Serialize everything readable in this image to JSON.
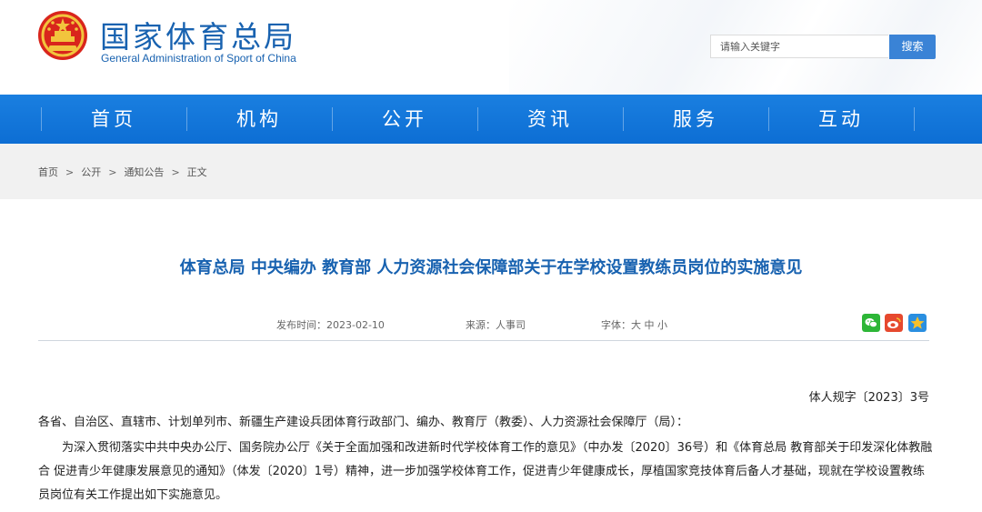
{
  "header": {
    "title": "国家体育总局",
    "subtitle": "General Administration of Sport of China",
    "emblem_icon": "national-emblem-icon"
  },
  "search": {
    "placeholder": "请输入关键字",
    "button_label": "搜索"
  },
  "nav": {
    "items": [
      {
        "label": "首页"
      },
      {
        "label": "机构"
      },
      {
        "label": "公开"
      },
      {
        "label": "资讯"
      },
      {
        "label": "服务"
      },
      {
        "label": "互动"
      }
    ]
  },
  "breadcrumb": {
    "items": [
      "首页",
      "公开",
      "通知公告",
      "正文"
    ],
    "separator": ">"
  },
  "article": {
    "title": "体育总局 中央编办 教育部 人力资源社会保障部关于在学校设置教练员岗位的实施意见",
    "publish_time": "发布时间：2023-02-10",
    "source": "来源：人事司",
    "font_size_label": "字体：大 中 小",
    "share_icons": [
      "wechat-icon",
      "weibo-icon",
      "qzone-icon"
    ],
    "doc_number": "体人规字〔2023〕3号",
    "addressee": "各省、自治区、直辖市、计划单列市、新疆生产建设兵团体育行政部门、编办、教育厅（教委）、人力资源社会保障厅（局）：",
    "paragraph_1": "为深入贯彻落实中共中央办公厅、国务院办公厅《关于全面加强和改进新时代学校体育工作的意见》（中办发〔2020〕36号）和《体育总局 教育部关于印发深化体教融合 促进青少年健康发展意见的通知》（体发〔2020〕1号）精神，进一步加强学校体育工作，促进青少年健康成长，厚植国家竞技体育后备人才基础，现就在学校设置教练员岗位有关工作提出如下实施意见。"
  },
  "colors": {
    "brand_blue": "#1862b0",
    "nav_blue": "#0d6ed4",
    "search_button": "#3a83d6"
  }
}
